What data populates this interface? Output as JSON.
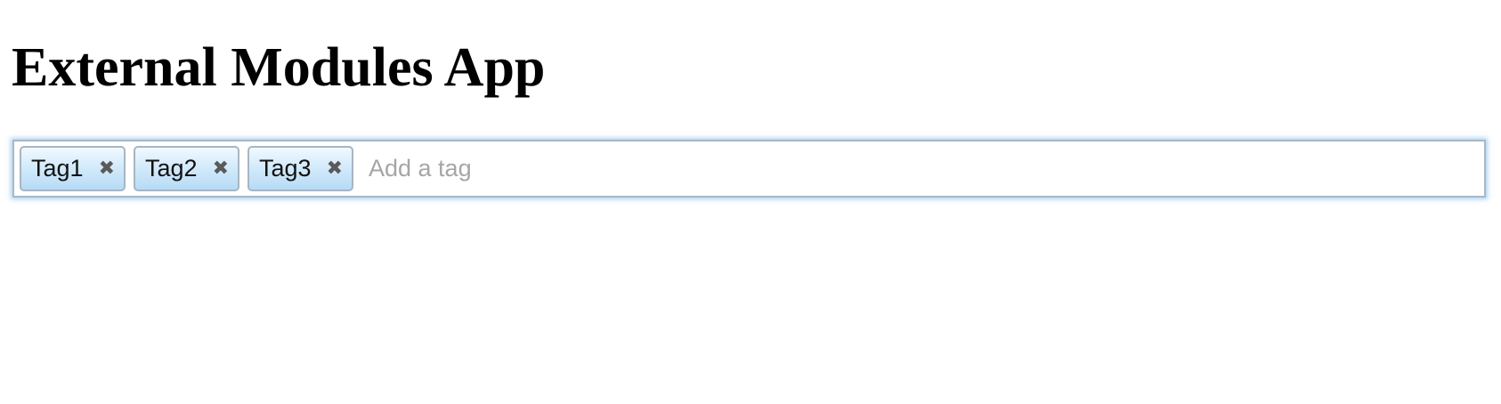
{
  "page": {
    "title": "External Modules App"
  },
  "tags_input": {
    "tags": [
      {
        "label": "Tag1",
        "remove_glyph": "✖",
        "remove_icon": "close-icon"
      },
      {
        "label": "Tag2",
        "remove_glyph": "✖",
        "remove_icon": "close-icon"
      },
      {
        "label": "Tag3",
        "remove_glyph": "✖",
        "remove_icon": "close-icon"
      }
    ],
    "value": "",
    "placeholder": "Add a tag"
  },
  "colors": {
    "focus_glow": "#66afe9",
    "tag_gradient_top": "#f1f9ff",
    "tag_gradient_bottom": "#b6dbf6",
    "tag_border": "#a7b6c2",
    "placeholder": "#a6a6a6"
  }
}
